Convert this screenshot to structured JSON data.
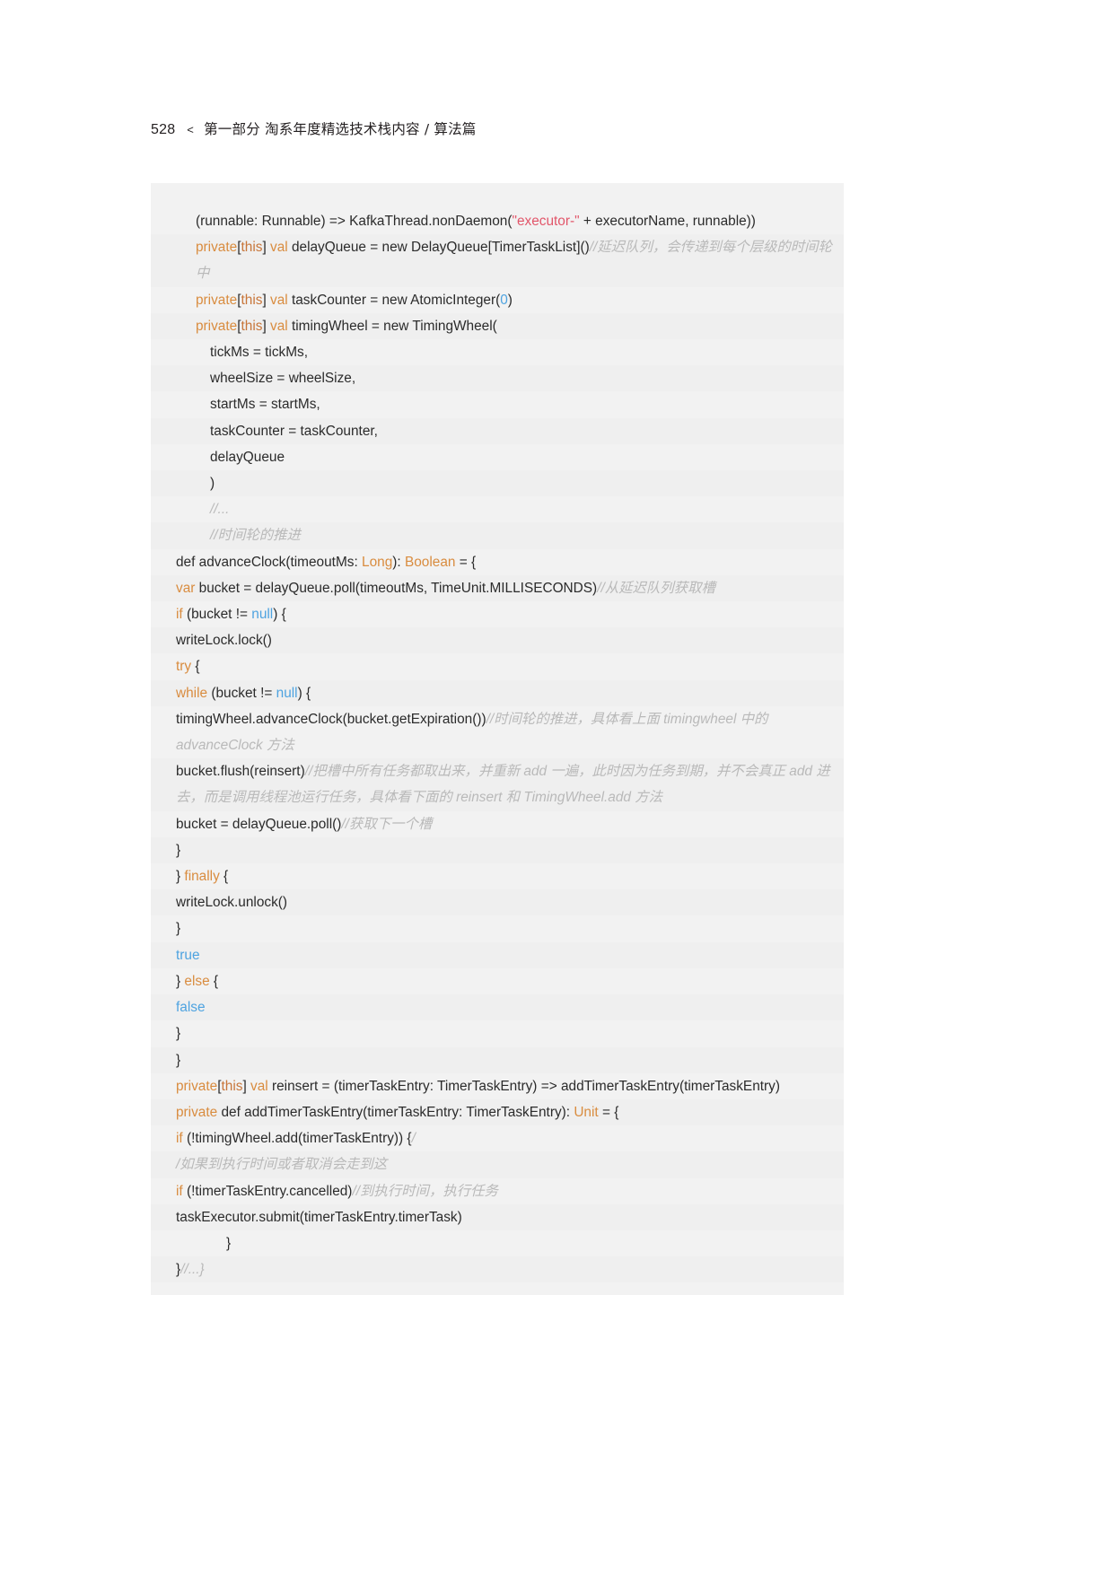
{
  "page": {
    "folio": "528",
    "separator": "<",
    "header_title": "第一部分  淘系年度精选技术栈内容 / 算法篇",
    "background": "#ffffff"
  },
  "colors": {
    "code_background": "#f2f2f2",
    "code_background_alt": "#efefef",
    "text": "#2b2b2b",
    "keyword": "#d98c3f",
    "string": "#e2566a",
    "number": "#4ea3e0",
    "literal": "#4ea3e0",
    "comment": "#b9b9b9"
  },
  "code": {
    "language": "scala",
    "lines": [
      {
        "indent": 1,
        "tokens": [
          {
            "t": "(runnable: Runnable) => KafkaThread.nonDaemon(",
            "c": "plain"
          },
          {
            "t": "\"executor-\"",
            "c": "str"
          },
          {
            "t": " + executorName, runnable))",
            "c": "plain"
          }
        ]
      },
      {
        "indent": 1,
        "tokens": [
          {
            "t": "private",
            "c": "kw"
          },
          {
            "t": "[",
            "c": "plain"
          },
          {
            "t": "this",
            "c": "kw2"
          },
          {
            "t": "]",
            "c": "plain"
          },
          {
            "t": " ",
            "c": "plain"
          },
          {
            "t": "val",
            "c": "kw"
          },
          {
            "t": " delayQueue = new DelayQueue[TimerTaskList]()",
            "c": "plain"
          },
          {
            "t": "//延迟队列，会传递到每个层级的时间轮中",
            "c": "cmt"
          }
        ]
      },
      {
        "indent": 1,
        "tokens": [
          {
            "t": "private",
            "c": "kw"
          },
          {
            "t": "[",
            "c": "plain"
          },
          {
            "t": "this",
            "c": "kw2"
          },
          {
            "t": "]",
            "c": "plain"
          },
          {
            "t": " ",
            "c": "plain"
          },
          {
            "t": "val",
            "c": "kw"
          },
          {
            "t": " taskCounter = new AtomicInteger(",
            "c": "plain"
          },
          {
            "t": "0",
            "c": "num"
          },
          {
            "t": ")",
            "c": "plain"
          }
        ]
      },
      {
        "indent": 1,
        "tokens": [
          {
            "t": "private",
            "c": "kw"
          },
          {
            "t": "[",
            "c": "plain"
          },
          {
            "t": "this",
            "c": "kw2"
          },
          {
            "t": "]",
            "c": "plain"
          },
          {
            "t": " ",
            "c": "plain"
          },
          {
            "t": "val",
            "c": "kw"
          },
          {
            "t": " timingWheel = new TimingWheel(",
            "c": "plain"
          }
        ]
      },
      {
        "indent": 2,
        "tokens": [
          {
            "t": "tickMs = tickMs,",
            "c": "plain"
          }
        ]
      },
      {
        "indent": 2,
        "tokens": [
          {
            "t": "wheelSize = wheelSize,",
            "c": "plain"
          }
        ]
      },
      {
        "indent": 2,
        "tokens": [
          {
            "t": "startMs = startMs,",
            "c": "plain"
          }
        ]
      },
      {
        "indent": 2,
        "tokens": [
          {
            "t": "taskCounter = taskCounter,",
            "c": "plain"
          }
        ]
      },
      {
        "indent": 2,
        "tokens": [
          {
            "t": "delayQueue",
            "c": "plain"
          }
        ]
      },
      {
        "indent": 2,
        "tokens": [
          {
            "t": ")",
            "c": "plain"
          }
        ]
      },
      {
        "indent": 2,
        "tokens": [
          {
            "t": "//...",
            "c": "cmt"
          }
        ]
      },
      {
        "indent": 2,
        "tokens": [
          {
            "t": "//时间轮的推进",
            "c": "cmt"
          }
        ]
      },
      {
        "indent": 0,
        "tokens": [
          {
            "t": "def advanceClock(timeoutMs: ",
            "c": "plain"
          },
          {
            "t": "Long",
            "c": "typ"
          },
          {
            "t": "): ",
            "c": "plain"
          },
          {
            "t": "Boolean",
            "c": "typ"
          },
          {
            "t": " = {",
            "c": "plain"
          }
        ]
      },
      {
        "indent": 0,
        "tokens": [
          {
            "t": "var",
            "c": "kw"
          },
          {
            "t": " bucket = delayQueue.poll(timeoutMs, TimeUnit.MILLISECONDS)",
            "c": "plain"
          },
          {
            "t": "//从延迟队列获取槽",
            "c": "cmt"
          }
        ]
      },
      {
        "indent": 0,
        "tokens": [
          {
            "t": "if",
            "c": "kw"
          },
          {
            "t": " (bucket != ",
            "c": "plain"
          },
          {
            "t": "null",
            "c": "lit"
          },
          {
            "t": ") {",
            "c": "plain"
          }
        ]
      },
      {
        "indent": 0,
        "tokens": [
          {
            "t": "writeLock.lock()",
            "c": "plain"
          }
        ]
      },
      {
        "indent": 0,
        "tokens": [
          {
            "t": "try",
            "c": "kw"
          },
          {
            "t": " {",
            "c": "plain"
          }
        ]
      },
      {
        "indent": 0,
        "tokens": [
          {
            "t": "while",
            "c": "kw"
          },
          {
            "t": " (bucket != ",
            "c": "plain"
          },
          {
            "t": "null",
            "c": "lit"
          },
          {
            "t": ") {",
            "c": "plain"
          }
        ]
      },
      {
        "indent": 0,
        "tokens": [
          {
            "t": "timingWheel.advanceClock(bucket.getExpiration())",
            "c": "plain"
          },
          {
            "t": "//时间轮的推进，具体看上面 timingwheel 中的 advanceClock 方法",
            "c": "cmt"
          }
        ]
      },
      {
        "indent": 0,
        "tokens": [
          {
            "t": "bucket.flush(reinsert)",
            "c": "plain"
          },
          {
            "t": "//把槽中所有任务都取出来，并重新 add 一遍，此时因为任务到期，并不会真正 add 进去，而是调用线程池运行任务，具体看下面的 reinsert 和 TimingWheel.add 方法",
            "c": "cmt"
          }
        ]
      },
      {
        "indent": 0,
        "tokens": [
          {
            "t": "bucket = delayQueue.poll()",
            "c": "plain"
          },
          {
            "t": "//获取下一个槽",
            "c": "cmt"
          }
        ]
      },
      {
        "indent": 0,
        "tokens": [
          {
            "t": "}",
            "c": "plain"
          }
        ]
      },
      {
        "indent": 0,
        "tokens": [
          {
            "t": "} ",
            "c": "plain"
          },
          {
            "t": "finally",
            "c": "kw"
          },
          {
            "t": " {",
            "c": "plain"
          }
        ]
      },
      {
        "indent": 0,
        "tokens": [
          {
            "t": "writeLock.unlock()",
            "c": "plain"
          }
        ]
      },
      {
        "indent": 0,
        "tokens": [
          {
            "t": "}",
            "c": "plain"
          }
        ]
      },
      {
        "indent": 0,
        "tokens": [
          {
            "t": "true",
            "c": "lit"
          }
        ]
      },
      {
        "indent": 0,
        "tokens": [
          {
            "t": "} ",
            "c": "plain"
          },
          {
            "t": "else",
            "c": "kw"
          },
          {
            "t": " {",
            "c": "plain"
          }
        ]
      },
      {
        "indent": 0,
        "tokens": [
          {
            "t": "false",
            "c": "lit"
          }
        ]
      },
      {
        "indent": 0,
        "tokens": [
          {
            "t": "}",
            "c": "plain"
          }
        ]
      },
      {
        "indent": 0,
        "tokens": [
          {
            "t": "}",
            "c": "plain"
          }
        ]
      },
      {
        "indent": 0,
        "tokens": [
          {
            "t": "private",
            "c": "kw"
          },
          {
            "t": "[",
            "c": "plain"
          },
          {
            "t": "this",
            "c": "kw2"
          },
          {
            "t": "]",
            "c": "plain"
          },
          {
            "t": " ",
            "c": "plain"
          },
          {
            "t": "val",
            "c": "kw"
          },
          {
            "t": " reinsert = (timerTaskEntry: TimerTaskEntry) => addTimerTaskEntry(timerTaskEntry)",
            "c": "plain"
          }
        ]
      },
      {
        "indent": 0,
        "tokens": [
          {
            "t": "private",
            "c": "kw"
          },
          {
            "t": " def addTimerTaskEntry(timerTaskEntry: TimerTaskEntry): ",
            "c": "plain"
          },
          {
            "t": "Unit",
            "c": "typ"
          },
          {
            "t": " = {",
            "c": "plain"
          }
        ]
      },
      {
        "indent": 0,
        "tokens": [
          {
            "t": "if",
            "c": "kw"
          },
          {
            "t": " (!timingWheel.add(timerTaskEntry)) {",
            "c": "plain"
          },
          {
            "t": "/",
            "c": "cmt"
          }
        ]
      },
      {
        "indent": 0,
        "tokens": [
          {
            "t": "/如果到执行时间或者取消会走到这",
            "c": "cmt"
          }
        ]
      },
      {
        "indent": 0,
        "tokens": [
          {
            "t": "if",
            "c": "kw"
          },
          {
            "t": " (!timerTaskEntry.cancelled)",
            "c": "plain"
          },
          {
            "t": "//到执行时间，执行任务",
            "c": "cmt"
          }
        ]
      },
      {
        "indent": 0,
        "tokens": [
          {
            "t": "taskExecutor.submit(timerTaskEntry.timerTask)",
            "c": "plain"
          }
        ]
      },
      {
        "indent": 3,
        "tokens": [
          {
            "t": "}",
            "c": "plain"
          }
        ]
      },
      {
        "indent": 0,
        "tokens": [
          {
            "t": "}",
            "c": "plain"
          },
          {
            "t": "//...}",
            "c": "cmt"
          }
        ]
      }
    ]
  }
}
